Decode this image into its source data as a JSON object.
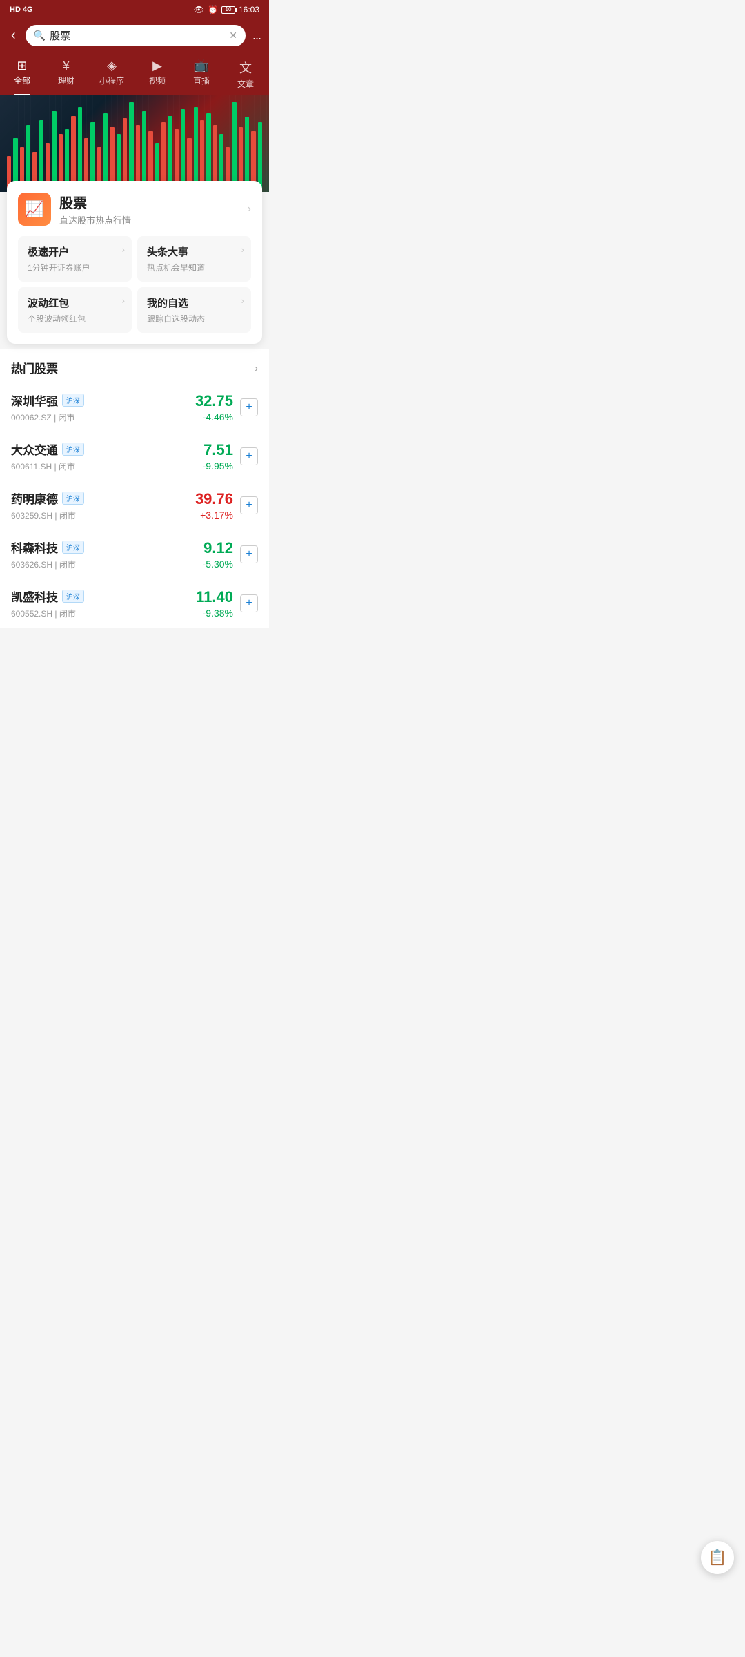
{
  "statusBar": {
    "left": "HD 4G",
    "time": "16:03",
    "battery": "10"
  },
  "header": {
    "searchPlaceholder": "股票",
    "searchValue": "股票",
    "backLabel": "back",
    "moreLabel": "..."
  },
  "tabs": [
    {
      "id": "all",
      "icon": "⊞",
      "label": "全部",
      "active": true
    },
    {
      "id": "wealth",
      "icon": "¥",
      "label": "理财",
      "active": false
    },
    {
      "id": "miniapp",
      "icon": "◈",
      "label": "小程序",
      "active": false
    },
    {
      "id": "video",
      "icon": "▶",
      "label": "视频",
      "active": false
    },
    {
      "id": "live",
      "icon": "📺",
      "label": "直播",
      "active": false
    },
    {
      "id": "text",
      "icon": "文",
      "label": "文章",
      "active": false
    }
  ],
  "mainCard": {
    "logo": "📈",
    "title": "股票",
    "subtitle": "直达股市热点行情",
    "chevron": "›",
    "quickLinks": [
      {
        "id": "open-account",
        "title": "极速开户",
        "desc": "1分钟开证券账户"
      },
      {
        "id": "headline",
        "title": "头条大事",
        "desc": "热点机会早知道"
      },
      {
        "id": "red-packet",
        "title": "波动红包",
        "desc": "个股波动领红包"
      },
      {
        "id": "watchlist",
        "title": "我的自选",
        "desc": "跟踪自选股动态"
      }
    ]
  },
  "hotStocks": {
    "sectionTitle": "热门股票",
    "moreIcon": "›",
    "stocks": [
      {
        "id": "sz-huaqiang",
        "name": "深圳华强",
        "tag": "沪深",
        "code": "000062.SZ",
        "status": "闭市",
        "price": "32.75",
        "change": "-4.46%",
        "priceColor": "green"
      },
      {
        "id": "sh-dazhong",
        "name": "大众交通",
        "tag": "沪深",
        "code": "600611.SH",
        "status": "闭市",
        "price": "7.51",
        "change": "-9.95%",
        "priceColor": "green"
      },
      {
        "id": "sh-yaoming",
        "name": "药明康德",
        "tag": "沪深",
        "code": "603259.SH",
        "status": "闭市",
        "price": "39.76",
        "change": "+3.17%",
        "priceColor": "red"
      },
      {
        "id": "sh-kesen",
        "name": "科森科技",
        "tag": "沪深",
        "code": "603626.SH",
        "status": "闭市",
        "price": "9.12",
        "change": "-5.30%",
        "priceColor": "green"
      },
      {
        "id": "sh-kaisheng",
        "name": "凯盛科技",
        "tag": "沪深",
        "code": "600552.SH",
        "status": "闭市",
        "price": "11.40",
        "change": "-9.38%",
        "priceColor": "green"
      }
    ]
  },
  "fab": {
    "icon": "📋"
  }
}
